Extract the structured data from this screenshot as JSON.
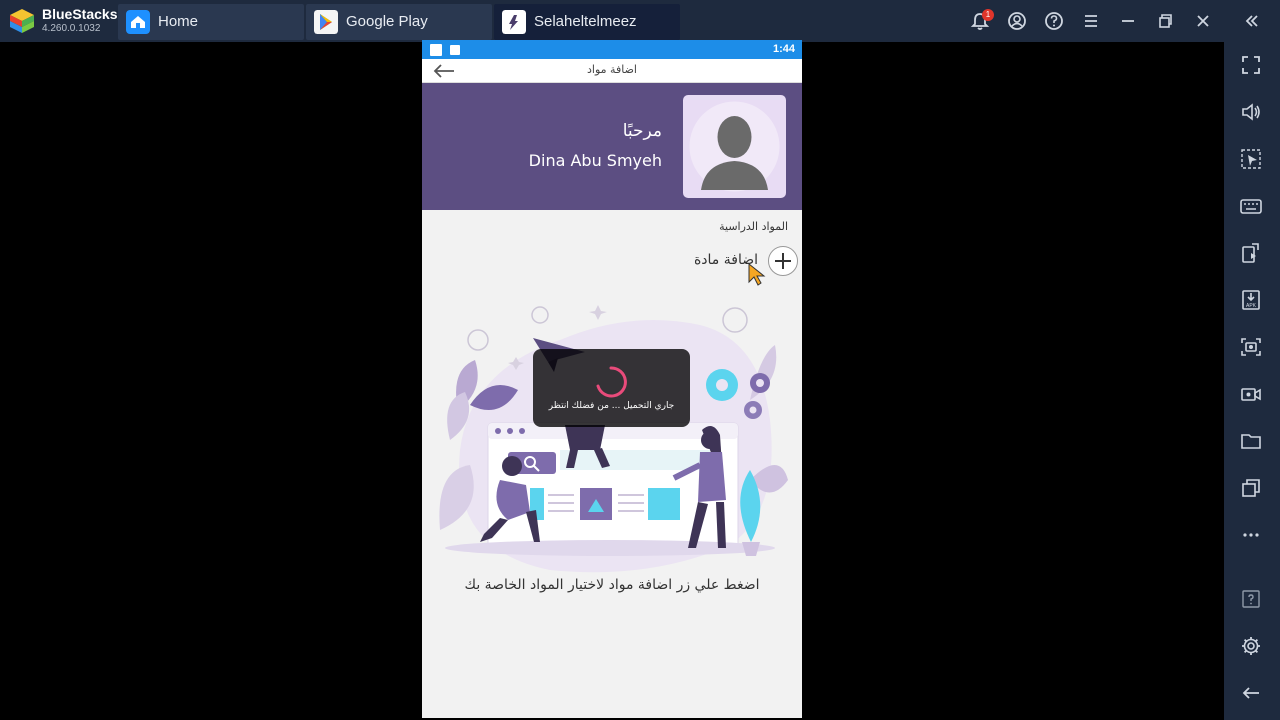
{
  "app": {
    "name": "BlueStacks",
    "version": "4.260.0.1032"
  },
  "tabs": [
    {
      "label": "Home",
      "icon": "home-icon"
    },
    {
      "label": "Google Play",
      "icon": "google-play-icon"
    },
    {
      "label": "Selaheltelmeez",
      "icon": "app-icon"
    }
  ],
  "toolbar": {
    "notification_count": "1",
    "icons": [
      "bell-icon",
      "account-icon",
      "help-icon",
      "menu-icon",
      "minimize-icon",
      "restore-icon",
      "close-icon",
      "collapse-icon"
    ]
  },
  "sidebar": {
    "icons": [
      "fullscreen-icon",
      "volume-icon",
      "pointer-icon",
      "keyboard-icon",
      "install-apk-icon",
      "apk-icon",
      "screenshot-icon",
      "record-icon",
      "folder-icon",
      "multi-instance-icon",
      "more-icon",
      "help-icon",
      "settings-icon",
      "back-icon"
    ]
  },
  "phone": {
    "status_time": "1:44",
    "appbar_title": "اضافة مواد",
    "greeting": "مرحبًا",
    "user_name": "Dina Abu Smyeh",
    "section_label": "المواد الدراسية",
    "add_subject_label": "اضافة مادة",
    "loading_text": "جاري التحميل ... من فضلك انتظر",
    "hint_text": "اضغط علي زر اضافة مواد لاختيار المواد الخاصة بك"
  },
  "colors": {
    "titlebar": "#1e2a3e",
    "profile_bg": "#5c4e82",
    "status_bar": "#1d8de8",
    "accent_pink": "#e94b7b"
  }
}
